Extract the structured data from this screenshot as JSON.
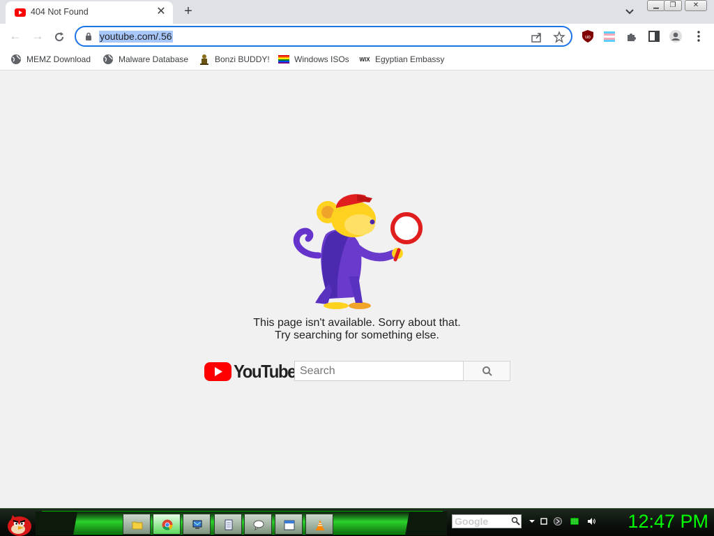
{
  "browser": {
    "tab": {
      "title": "404 Not Found"
    },
    "address": {
      "url": "youtube.com/.56"
    },
    "bookmarks": [
      {
        "label": "MEMZ Download",
        "icon": "globe-icon"
      },
      {
        "label": "Malware Database",
        "icon": "globe-icon"
      },
      {
        "label": "Bonzi BUDDY!",
        "icon": "bonzi-icon"
      },
      {
        "label": "Windows ISOs",
        "icon": "rainbow-flag-icon"
      },
      {
        "label": "Egyptian Embassy",
        "icon": "wix-icon"
      }
    ]
  },
  "page": {
    "message_line1": "This page isn't available. Sorry about that.",
    "message_line2": "Try searching for something else.",
    "logo_text": "YouTube",
    "search_placeholder": "Search"
  },
  "taskbar": {
    "clock": "12:47 PM",
    "search_box_text": "Google"
  },
  "colors": {
    "accent": "#1a73e8",
    "youtube_red": "#ff0000",
    "clock_green": "#00ff00"
  }
}
